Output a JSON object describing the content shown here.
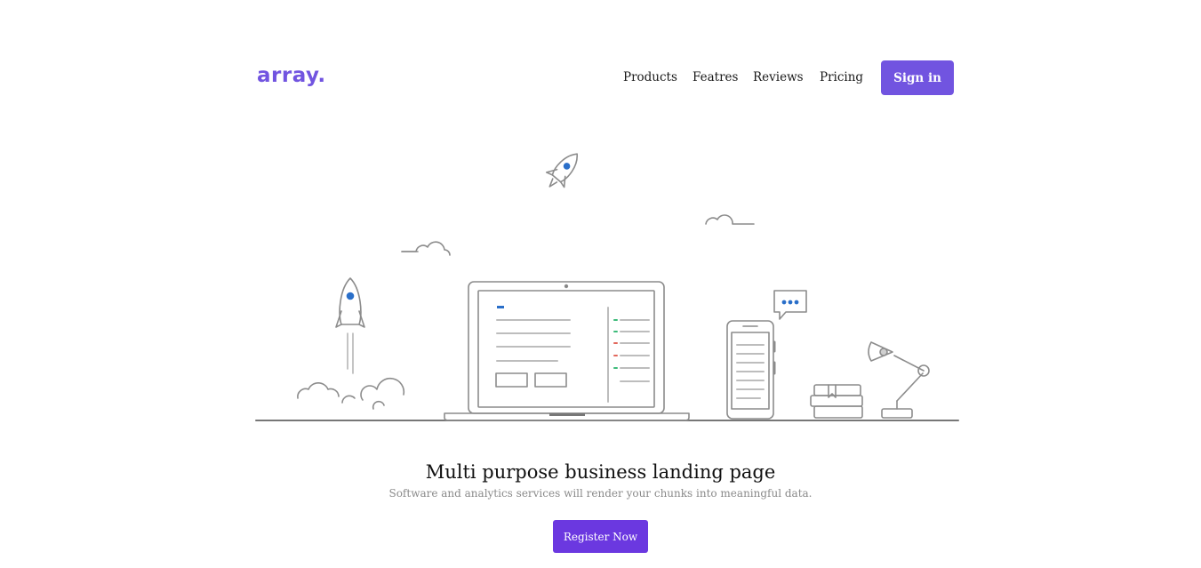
{
  "brand": {
    "logo_text": "array.",
    "accent_color": "#7154e0"
  },
  "nav": {
    "items": [
      {
        "label": "Products"
      },
      {
        "label": "Featres"
      },
      {
        "label": "Reviews"
      },
      {
        "label": "Pricing"
      }
    ],
    "signin_label": "Sign in"
  },
  "hero": {
    "illustration": "workspace-line-illustration",
    "title": "Multi purpose business landing page",
    "subtitle": "Software and analytics services will render your chunks into meaningful data.",
    "cta_label": "Register Now",
    "cta_color": "#6b38e0"
  }
}
